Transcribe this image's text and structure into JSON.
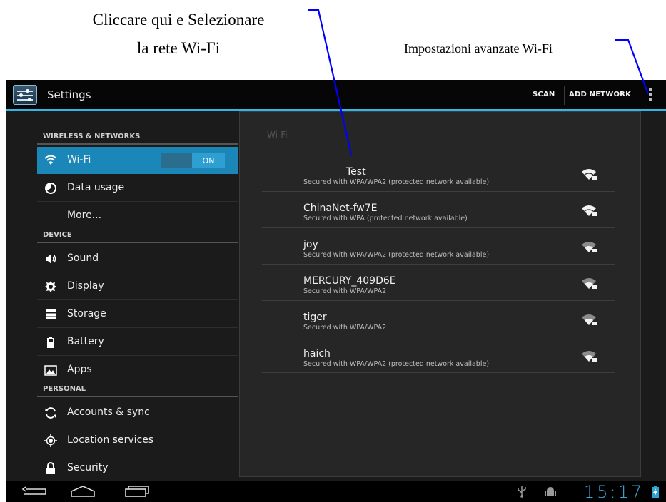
{
  "annotations": {
    "left_line1": "Cliccare qui e Selezionare",
    "left_line2": "la rete Wi-Fi",
    "right": "Impostazioni avanzate Wi-Fi",
    "line_color": "#0000ff"
  },
  "actionbar": {
    "title": "Settings",
    "scan_label": "SCAN",
    "add_network_label": "ADD NETWORK",
    "accent_color": "#33b5e5"
  },
  "sidebar": {
    "sections": {
      "wireless": "WIRELESS & NETWORKS",
      "device": "DEVICE",
      "personal": "PERSONAL"
    },
    "items": [
      {
        "label": "Wi-Fi",
        "icon": "wifi-icon",
        "selected": true
      },
      {
        "label": "Data usage",
        "icon": "data-usage-icon"
      },
      {
        "label": "More..."
      },
      {
        "label": "Sound",
        "icon": "speaker-icon"
      },
      {
        "label": "Display",
        "icon": "display-icon"
      },
      {
        "label": "Storage",
        "icon": "storage-icon"
      },
      {
        "label": "Battery",
        "icon": "battery-icon"
      },
      {
        "label": "Apps",
        "icon": "apps-icon"
      },
      {
        "label": "Accounts & sync",
        "icon": "sync-icon"
      },
      {
        "label": "Location services",
        "icon": "location-icon"
      },
      {
        "label": "Security",
        "icon": "lock-icon"
      }
    ],
    "wifi_toggle": "ON"
  },
  "panel": {
    "title": "Wi-Fi",
    "networks": [
      {
        "ssid": "Test",
        "security": "Secured with WPA/WPA2 (protected network available)",
        "signal": "strong"
      },
      {
        "ssid": "ChinaNet-fw7E",
        "security": "Secured with WPA (protected network available)",
        "signal": "strong"
      },
      {
        "ssid": "joy",
        "security": "Secured with WPA/WPA2 (protected network available)",
        "signal": "medium"
      },
      {
        "ssid": "MERCURY_409D6E",
        "security": "Secured with WPA/WPA2",
        "signal": "medium"
      },
      {
        "ssid": "tiger",
        "security": "Secured with WPA/WPA2",
        "signal": "medium"
      },
      {
        "ssid": "haich",
        "security": "Secured with WPA/WPA2 (protected network available)",
        "signal": "medium"
      }
    ]
  },
  "navbar": {
    "clock": "15:17",
    "icons": [
      "back-icon",
      "home-icon",
      "recent-apps-icon",
      "usb-icon",
      "android-debug-icon",
      "battery-charging-icon"
    ]
  }
}
